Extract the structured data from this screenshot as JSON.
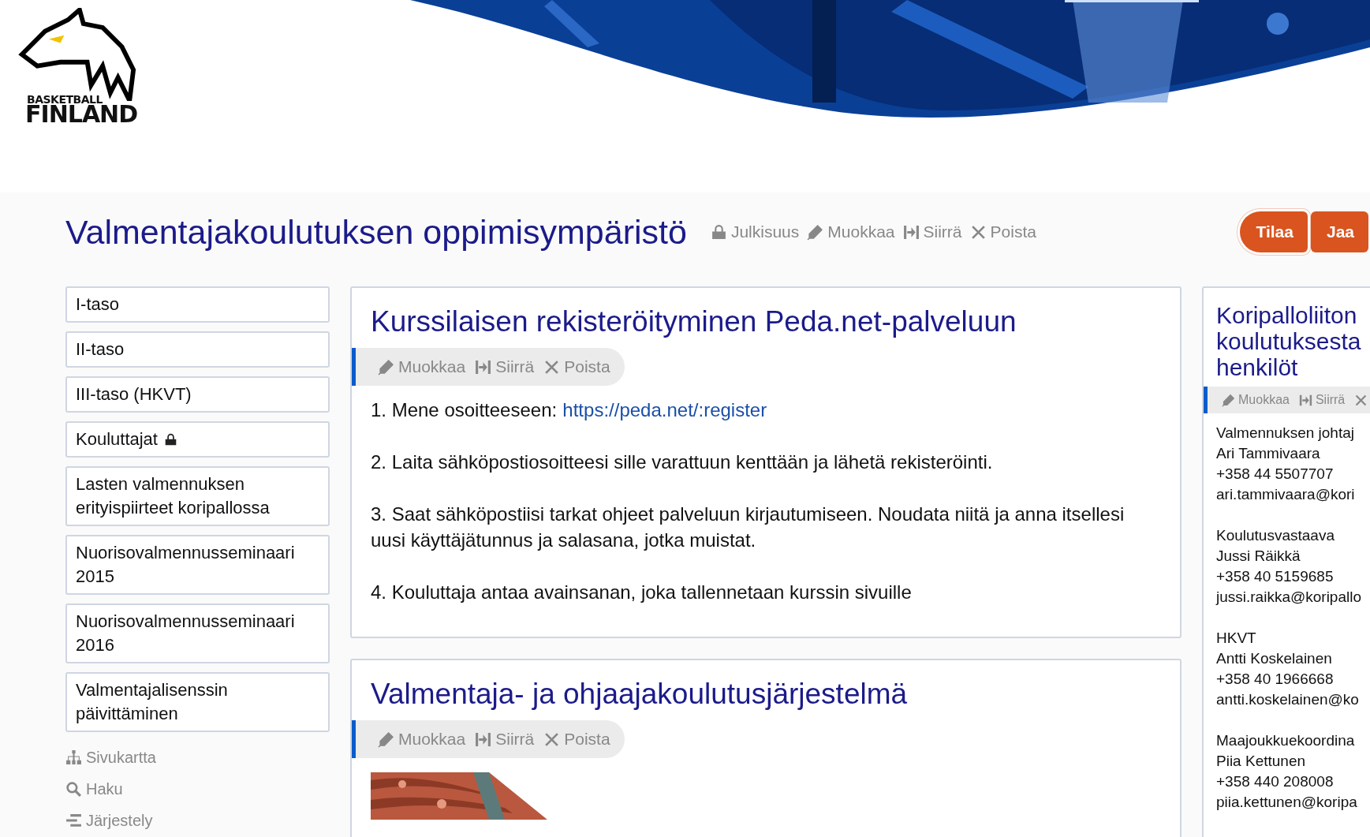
{
  "logo": {
    "line1": "BASKETBALL",
    "line2": "FINLAND"
  },
  "page_title": "Valmentajakoulutuksen oppimisympäristö",
  "page_actions": [
    {
      "kind": "lock",
      "label": "Julkisuus"
    },
    {
      "kind": "edit",
      "label": "Muokkaa"
    },
    {
      "kind": "move",
      "label": "Siirrä"
    },
    {
      "kind": "delete",
      "label": "Poista"
    }
  ],
  "buttons": [
    "Tilaa",
    "Jaa"
  ],
  "sidebar": {
    "items": [
      {
        "label": "I-taso",
        "locked": false
      },
      {
        "label": "II-taso",
        "locked": false
      },
      {
        "label": "III-taso (HKVT)",
        "locked": false
      },
      {
        "label": "Kouluttajat",
        "locked": true
      },
      {
        "label": "Lasten valmennuksen erityispiirteet koripallossa",
        "locked": false
      },
      {
        "label": "Nuorisovalmennusseminaari 2015",
        "locked": false
      },
      {
        "label": "Nuorisovalmennusseminaari 2016",
        "locked": false
      },
      {
        "label": "Valmentajalisenssin päivittäminen",
        "locked": false
      }
    ],
    "tools": [
      {
        "kind": "sitemap",
        "label": "Sivukartta"
      },
      {
        "kind": "search",
        "label": "Haku"
      },
      {
        "kind": "arrange",
        "label": "Järjestely"
      }
    ]
  },
  "cards": [
    {
      "title": "Kurssilaisen rekisteröityminen Peda.net-palveluun",
      "actions": [
        {
          "kind": "edit",
          "label": "Muokkaa"
        },
        {
          "kind": "move",
          "label": "Siirrä"
        },
        {
          "kind": "delete",
          "label": "Poista"
        }
      ],
      "paragraphs": [
        {
          "text": "1. Mene osoitteeseen:",
          "link": "https://peda.net/:register"
        },
        {
          "text": "2. Laita sähköpostiosoitteesi sille varattuun kenttään ja lähetä rekisteröinti."
        },
        {
          "text": "3. Saat sähköpostiisi tarkat ohjeet palveluun kirjautumiseen. Noudata niitä ja anna itsellesi uusi käyttäjätunnus ja salasana, jotka muistat."
        },
        {
          "text": "4. Kouluttaja antaa avainsanan, joka tallennetaan kurssin sivuille"
        }
      ]
    },
    {
      "title": "Valmentaja- ja ohjaajakoulutusjärjestelmä",
      "actions": [
        {
          "kind": "edit",
          "label": "Muokkaa"
        },
        {
          "kind": "move",
          "label": "Siirrä"
        },
        {
          "kind": "delete",
          "label": "Poista"
        }
      ],
      "picture": {
        "kind": "picture"
      }
    }
  ],
  "side_card": {
    "title_lines": [
      "Koripalloliiton",
      "koulutuksesta",
      "henkilöt"
    ],
    "actions": [
      {
        "kind": "edit",
        "label": "Muokkaa"
      },
      {
        "kind": "move",
        "label": "Siirrä"
      },
      {
        "kind": "delete"
      }
    ],
    "contacts": [
      [
        "Valmennuksen johtaj",
        "Ari Tammivaara",
        "+358 44 5507707",
        "ari.tammivaara@kori"
      ],
      [
        "Koulutusvastaava",
        "Jussi Räikkä",
        "+358 40 5159685",
        "jussi.raikka@koripallo"
      ],
      [
        "HKVT",
        "Antti Koskelainen",
        "+358 40 1966668",
        "antti.koskelainen@ko"
      ],
      [
        "Maajoukkuekoordina",
        "Piia Kettunen",
        "+358 440 208008",
        "piia.kettunen@koripa"
      ]
    ]
  }
}
